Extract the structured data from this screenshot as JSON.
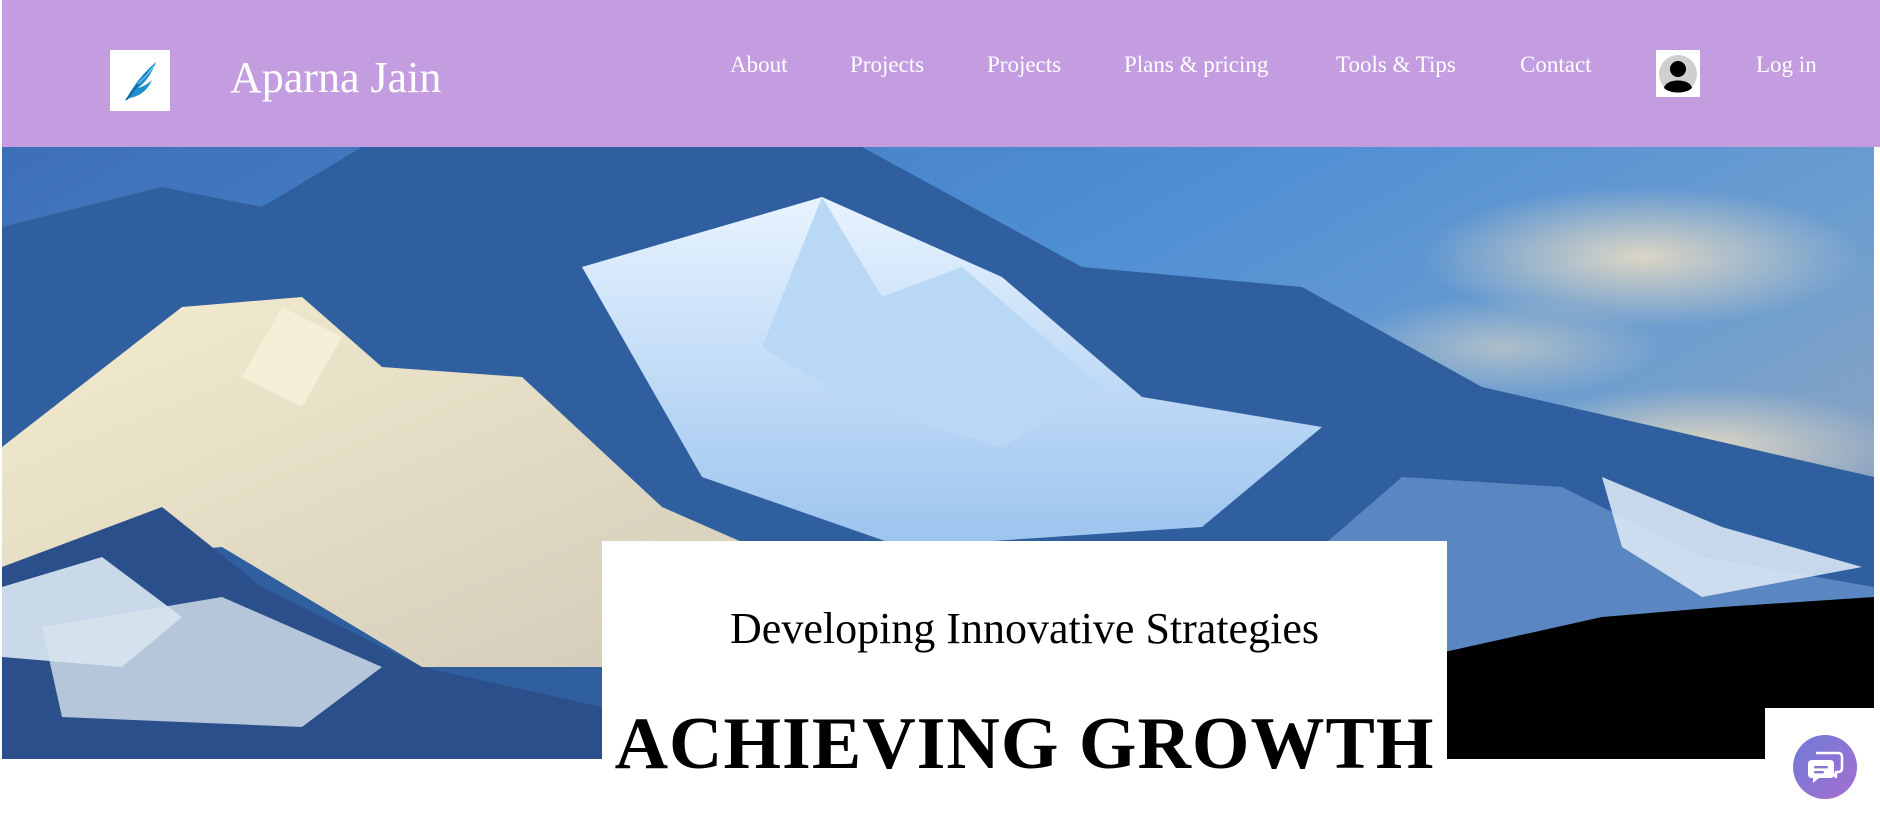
{
  "header": {
    "site_title": "Aparna Jain",
    "background_color": "#c39ddf",
    "logo_icon": "feather-logo-icon",
    "nav": [
      {
        "label": "About"
      },
      {
        "label": "Projects"
      },
      {
        "label": "Projects"
      },
      {
        "label": "Plans & pricing"
      },
      {
        "label": "Tools & Tips"
      },
      {
        "label": "Contact"
      }
    ],
    "avatar_icon": "user-avatar-icon",
    "login_label": "Log in"
  },
  "hero": {
    "image": "snowy-mountain-range-photo",
    "subtitle": "Developing Innovative Strategies",
    "headline": "ACHIEVING GROWTH"
  },
  "chat": {
    "icon": "chat-bubble-icon",
    "gradient_start": "#6f7ad8",
    "gradient_end": "#a56fd0"
  }
}
